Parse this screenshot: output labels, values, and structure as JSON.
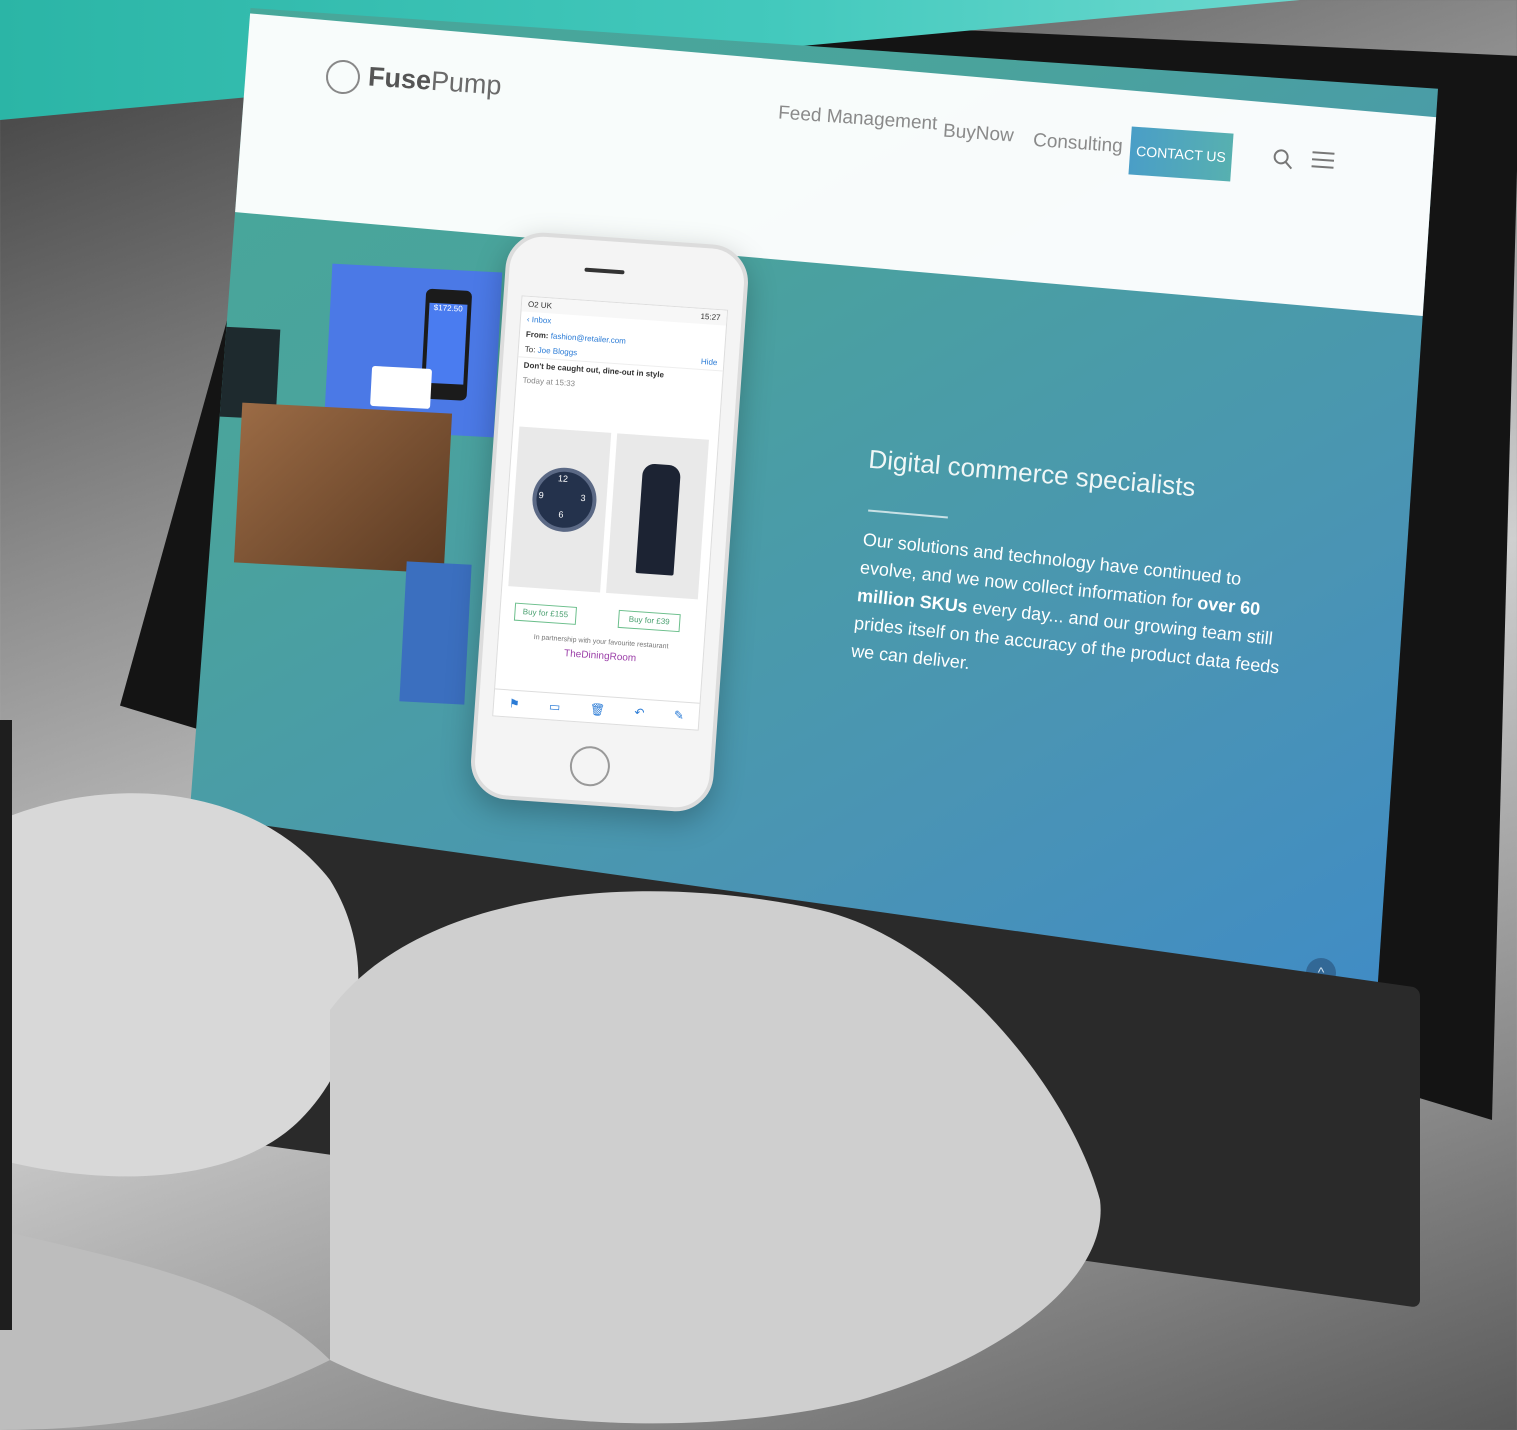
{
  "site": {
    "logo_text_bold": "Fuse",
    "logo_text": "Pump"
  },
  "nav": {
    "links": [
      "Feed Management",
      "BuyNow",
      "Consulting"
    ],
    "contact_label": "CONTACT US",
    "search_icon": "search-icon",
    "menu_icon": "hamburger-menu-icon"
  },
  "hero": {
    "title": "Digital commerce specialists",
    "body_part1": "Our solutions and technology have continued to evolve, and we now collect information for ",
    "body_bold": "over 60 million SKUs",
    "body_part2": " every day... and our growing team still prides itself on the accuracy of the product data feeds we can deliver."
  },
  "phone_email": {
    "back_label": "Inbox",
    "from_label": "From:",
    "from_value": "fashion@retailer.com",
    "to_label": "To:",
    "to_value": "Joe Bloggs",
    "hide_label": "Hide",
    "subject": "Don't be caught out, dine-out in style",
    "date": "Today at 15:33",
    "buy_left": "Buy for £155",
    "buy_right": "Buy for £39",
    "partner_text": "In partnership with your favourite restaurant",
    "partner_name": "TheDiningRoom",
    "status_time": "15:27",
    "carrier": "O2 UK",
    "price_label": "$172.50",
    "watch_numbers": [
      "12",
      "3",
      "9",
      "6"
    ]
  },
  "scroll_top_icon": "chevron-up-icon"
}
